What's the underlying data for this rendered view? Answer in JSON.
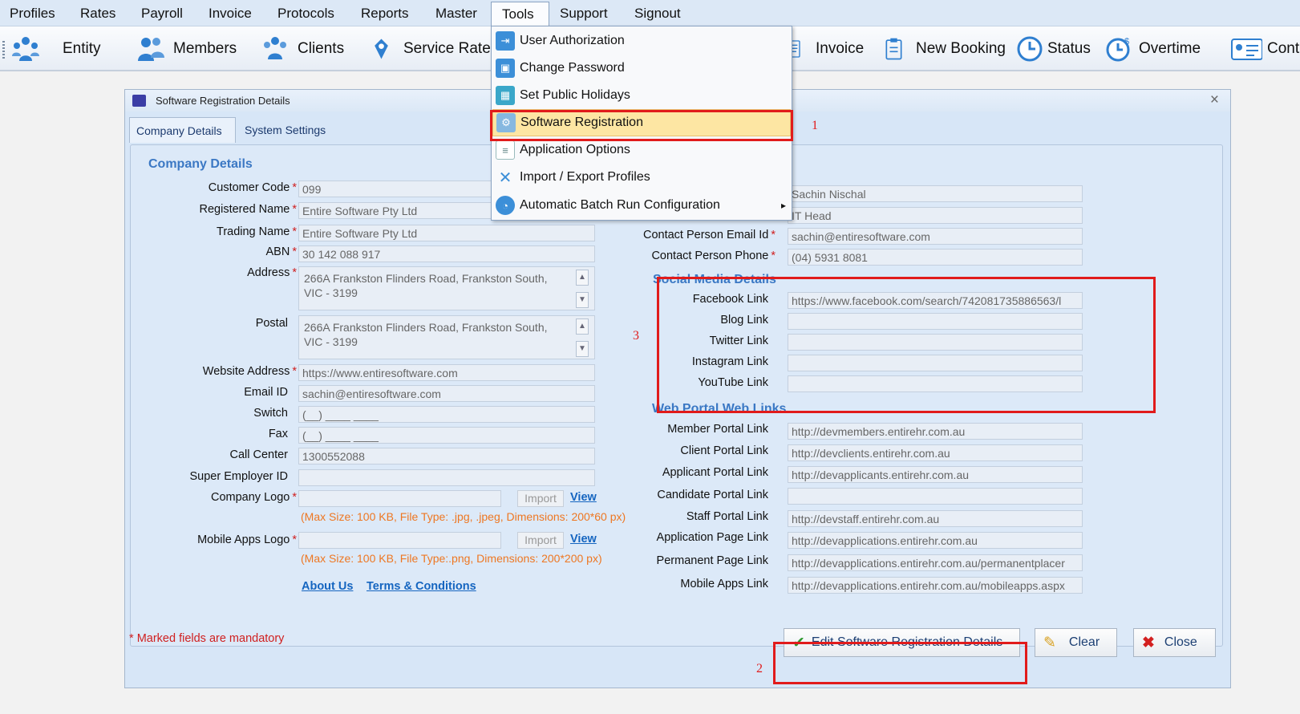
{
  "menubar": {
    "items": [
      "Profiles",
      "Rates",
      "Payroll",
      "Invoice",
      "Protocols",
      "Reports",
      "Master",
      "Tools",
      "Support",
      "Signout"
    ]
  },
  "toolbar": {
    "entity": "Entity",
    "members": "Members",
    "clients": "Clients",
    "service_rate": "Service Rate",
    "invoice": "Invoice",
    "new_booking": "New Booking",
    "status": "Status",
    "overtime": "Overtime",
    "cont": "Cont"
  },
  "tools_menu": {
    "items": [
      "User Authorization",
      "Change Password",
      "Set Public Holidays",
      "Software Registration",
      "Application Options",
      "Import / Export Profiles",
      "Automatic Batch Run Configuration"
    ],
    "arrow": "▸"
  },
  "dialog": {
    "title": "Software Registration Details",
    "close": "×",
    "tabs": [
      "Company Details",
      "System Settings"
    ]
  },
  "company": {
    "heading": "Company Details",
    "labels": {
      "customer_code": "Customer Code",
      "registered_name": "Registered Name",
      "trading_name": "Trading Name",
      "abn": "ABN",
      "address": "Address",
      "postal": "Postal",
      "website": "Website Address",
      "email": "Email ID",
      "switch": "Switch",
      "fax": "Fax",
      "call_center": "Call Center",
      "super_employer": "Super Employer ID",
      "company_logo": "Company Logo",
      "mobile_logo": "Mobile Apps Logo"
    },
    "values": {
      "customer_code": "099",
      "registered_name": "Entire Software Pty Ltd",
      "trading_name": "Entire Software Pty Ltd",
      "abn": "30 142 088 917",
      "address_1": "266A Frankston Flinders Road, Frankston South,",
      "address_2": "VIC - 3199",
      "postal_1": "266A Frankston Flinders Road, Frankston South,",
      "postal_2": "VIC - 3199",
      "website": "https://www.entiresoftware.com",
      "email": "sachin@entiresoftware.com",
      "switch": "(__) ____ ____",
      "fax": "(__) ____ ____",
      "call_center": "1300552088",
      "super_employer": "",
      "company_logo": "",
      "mobile_logo": ""
    },
    "import_label": "Import",
    "view_label": "View",
    "logo_note": "(Max Size: 100 KB, File Type: .jpg, .jpeg, Dimensions: 200*60 px)",
    "mobile_note": "(Max Size: 100 KB, File Type:.png, Dimensions: 200*200 px)",
    "about_us": "About Us",
    "terms": "Terms & Conditions"
  },
  "contact": {
    "labels": {
      "email": "Contact Person Email Id",
      "phone": "Contact Person Phone"
    },
    "values": {
      "name": "Sachin Nischal",
      "designation": "IT Head",
      "email": "sachin@entiresoftware.com",
      "phone": "(04) 5931 8081"
    }
  },
  "social": {
    "heading": "Social Media Details",
    "labels": {
      "facebook": "Facebook Link",
      "blog": "Blog Link",
      "twitter": "Twitter Link",
      "instagram": "Instagram Link",
      "youtube": "YouTube Link"
    },
    "values": {
      "facebook": "https://www.facebook.com/search/742081735886563/l",
      "blog": "",
      "twitter": "",
      "instagram": "",
      "youtube": ""
    }
  },
  "portal": {
    "heading": "Web Portal Web Links",
    "labels": {
      "member": "Member Portal Link",
      "client": "Client Portal Link",
      "applicant": "Applicant Portal Link",
      "candidate": "Candidate Portal Link",
      "staff": "Staff Portal Link",
      "application": "Application Page Link",
      "permanent": "Permanent Page Link",
      "mobile": "Mobile Apps Link"
    },
    "values": {
      "member": "http://devmembers.entirehr.com.au",
      "client": "http://devclients.entirehr.com.au",
      "applicant": "http://devapplicants.entirehr.com.au",
      "candidate": "",
      "staff": "http://devstaff.entirehr.com.au",
      "application": "http://devapplications.entirehr.com.au",
      "permanent": "http://devapplications.entirehr.com.au/permanentplacer",
      "mobile": "http://devapplications.entirehr.com.au/mobileapps.aspx"
    }
  },
  "mandatory_note": "Marked fields are mandatory",
  "required_mark": "*",
  "buttons": {
    "edit": "Edit Software Registration Details",
    "clear": "Clear",
    "close": "Close"
  },
  "annotations": {
    "n1": "1",
    "n2": "2",
    "n3": "3"
  },
  "colors": {
    "annotation_red": "#e11b1b",
    "section_blue": "#3b78c4",
    "link_blue": "#1565c0",
    "note_orange": "#ee7722",
    "highlight": "#fde6a3"
  }
}
